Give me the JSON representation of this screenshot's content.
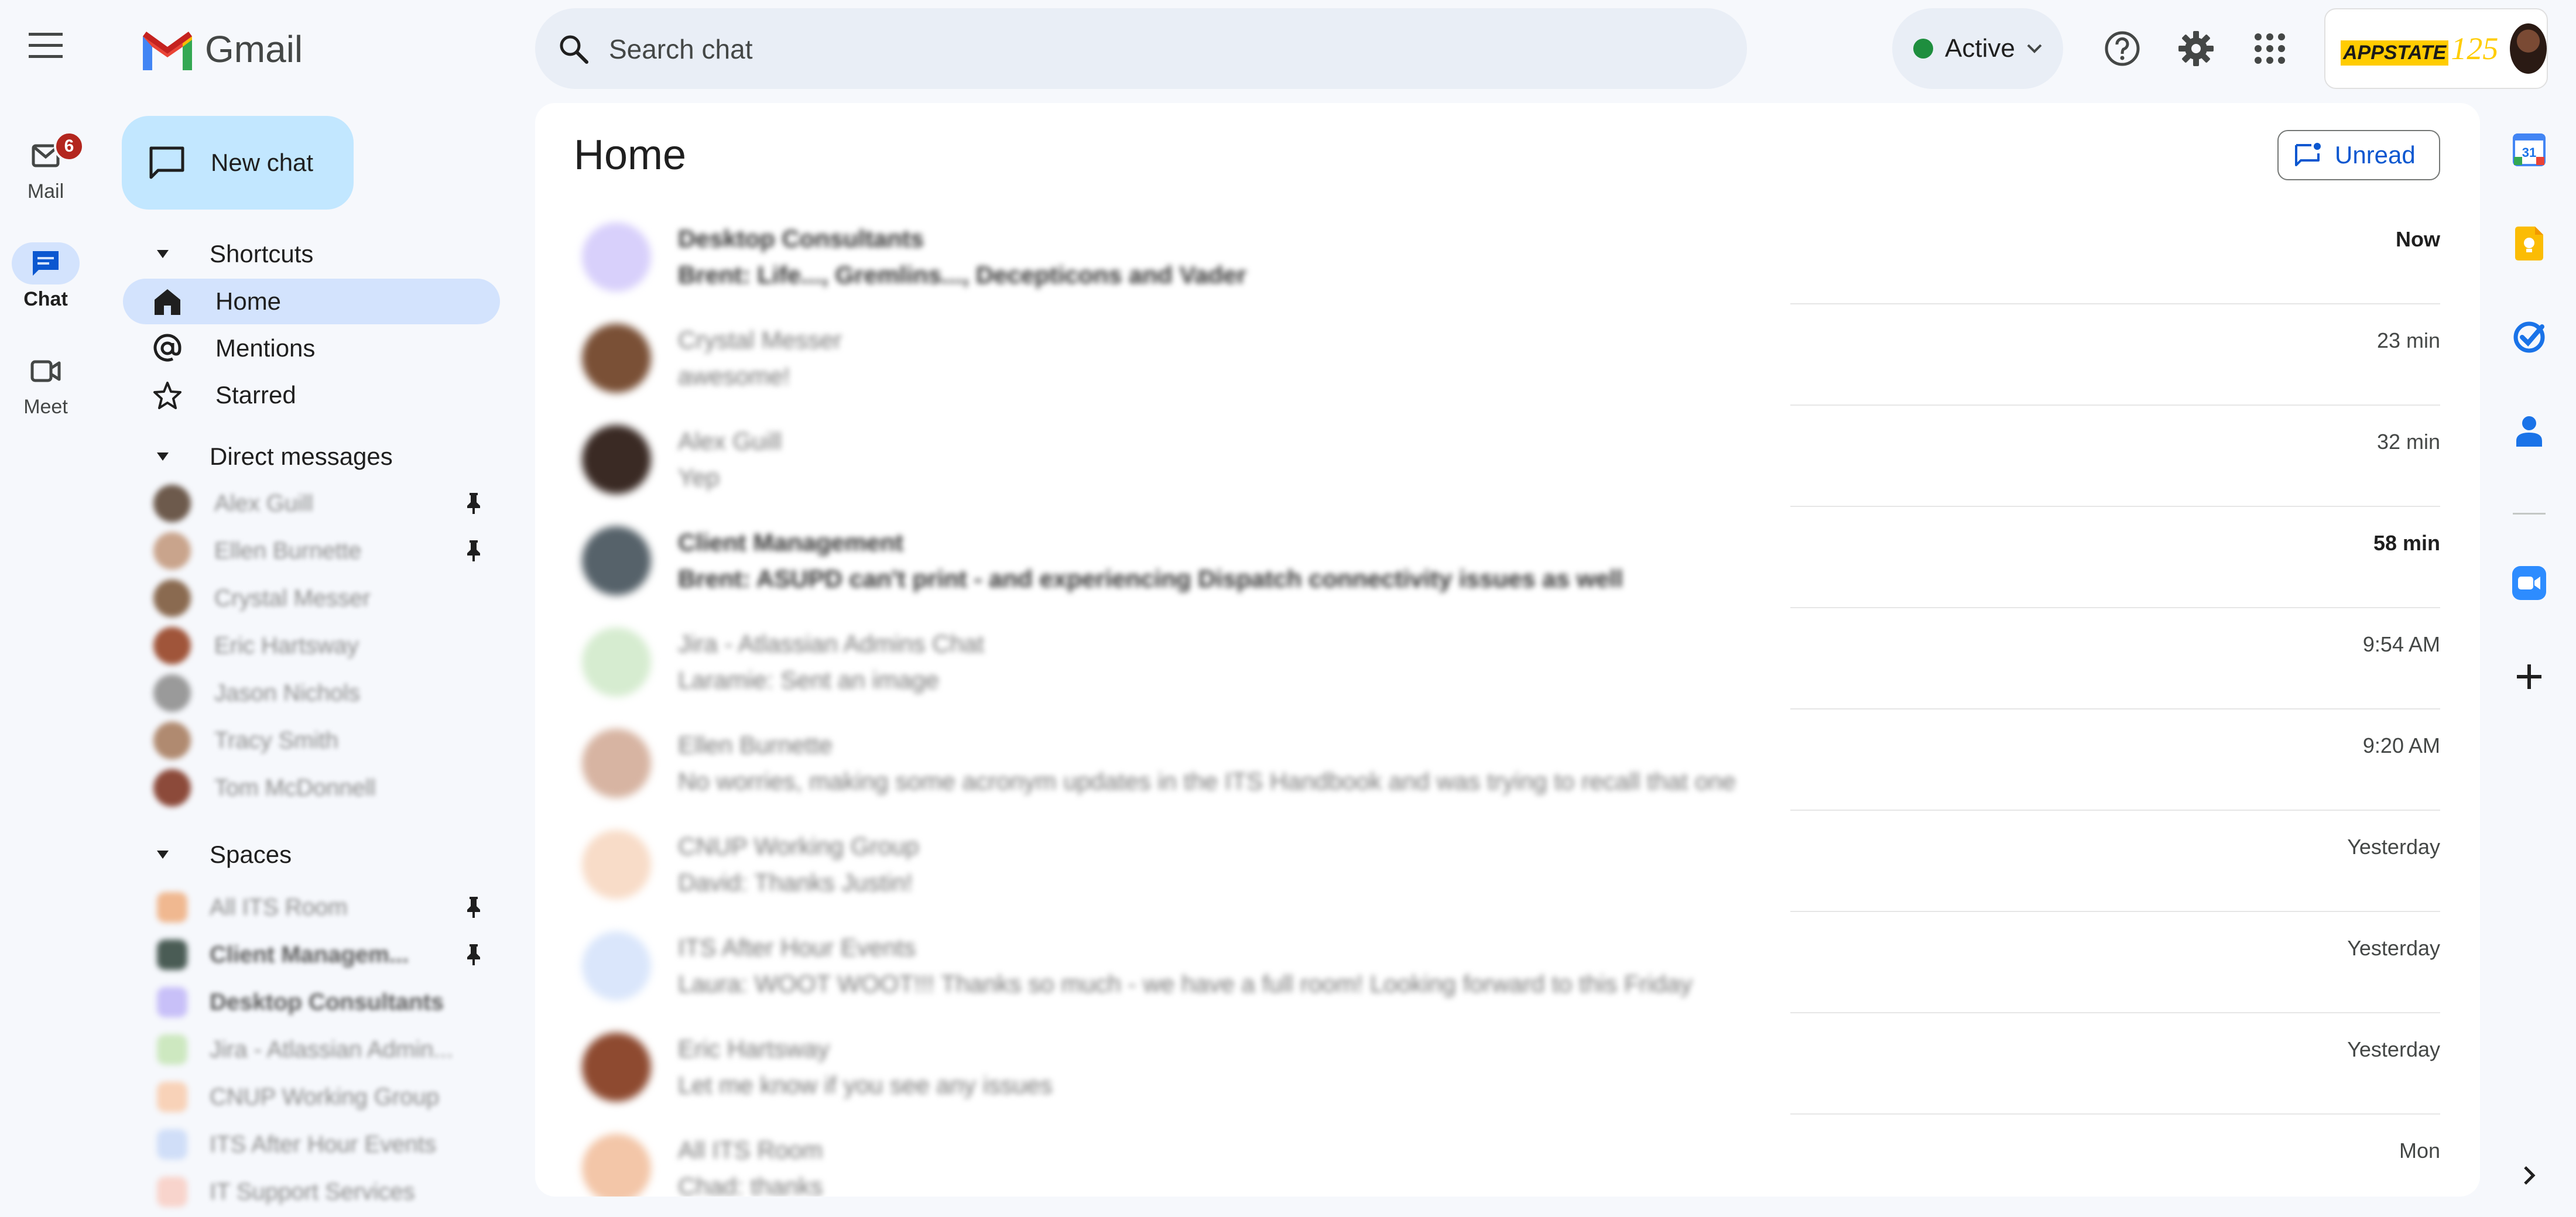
{
  "app": {
    "name": "Gmail",
    "logo_icon": "gmail-logo-icon"
  },
  "rail": [
    {
      "label": "Mail",
      "icon": "mail-icon",
      "badge": "6",
      "active": false
    },
    {
      "label": "Chat",
      "icon": "chat-icon",
      "active": true
    },
    {
      "label": "Meet",
      "icon": "meet-video-icon",
      "active": false
    }
  ],
  "header": {
    "search_placeholder": "Search chat",
    "status_label": "Active",
    "status_color": "#1e8e3e",
    "icons": [
      "help-icon",
      "settings-gear-icon",
      "apps-grid-icon"
    ],
    "org_logo_text": "APPSTATE",
    "org_logo_number": "125"
  },
  "sidebar": {
    "new_chat_label": "New chat",
    "shortcuts": {
      "heading": "Shortcuts",
      "items": [
        {
          "label": "Home",
          "icon": "home-icon",
          "active": true
        },
        {
          "label": "Mentions",
          "icon": "at-sign-icon",
          "active": false
        },
        {
          "label": "Starred",
          "icon": "star-icon",
          "active": false
        }
      ]
    },
    "direct_messages": {
      "heading": "Direct messages",
      "items": [
        {
          "name": "Alex Guill",
          "pinned": true,
          "avatar_color": "#6d5a4c"
        },
        {
          "name": "Ellen Burnette",
          "pinned": true,
          "avatar_color": "#c9a48c"
        },
        {
          "name": "Crystal Messer",
          "pinned": false,
          "avatar_color": "#8a6a50"
        },
        {
          "name": "Eric Hartsway",
          "pinned": false,
          "avatar_color": "#a0553a"
        },
        {
          "name": "Jason Nichols",
          "pinned": false,
          "avatar_color": "#9a9a9a"
        },
        {
          "name": "Tracy Smith",
          "pinned": false,
          "avatar_color": "#b08a70"
        },
        {
          "name": "Tom McDonnell",
          "pinned": false,
          "avatar_color": "#8c4a3a"
        }
      ]
    },
    "spaces": {
      "heading": "Spaces",
      "items": [
        {
          "name": "All ITS Room",
          "pinned": true,
          "bold": false,
          "avatar_color": "#f0b890"
        },
        {
          "name": "Client Managem...",
          "pinned": true,
          "bold": true,
          "avatar_color": "#4a5c55"
        },
        {
          "name": "Desktop Consultants",
          "pinned": false,
          "bold": true,
          "avatar_color": "#c8c0f8"
        },
        {
          "name": "Jira - Atlassian Admin...",
          "pinned": false,
          "bold": false,
          "avatar_color": "#cde8c0"
        },
        {
          "name": "CNUP Working Group",
          "pinned": false,
          "bold": false,
          "avatar_color": "#f8d2b8"
        },
        {
          "name": "ITS After Hour Events",
          "pinned": false,
          "bold": false,
          "avatar_color": "#d0def8"
        },
        {
          "name": "IT Support Services",
          "pinned": false,
          "bold": false,
          "avatar_color": "#f8d4cc"
        }
      ]
    }
  },
  "main": {
    "title": "Home",
    "unread_label": "Unread",
    "conversations": [
      {
        "name": "Desktop Consultants",
        "snippet": "Brent: Life..., Gremlins..., Decepticons and Vader",
        "time": "Now",
        "bold": true,
        "avatar_color": "#d8d0fb"
      },
      {
        "name": "Crystal Messer",
        "snippet": "awesome!",
        "time": "23 min",
        "bold": false,
        "avatar_color": "#7a5036"
      },
      {
        "name": "Alex Guill",
        "snippet": "Yep",
        "time": "32 min",
        "bold": false,
        "avatar_color": "#3a2a24"
      },
      {
        "name": "Client Management",
        "snippet": "Brent: ASUPD can't print - and experiencing Dispatch connectivity issues as well",
        "time": "58 min",
        "bold": true,
        "avatar_color": "#56626a"
      },
      {
        "name": "Jira - Atlassian Admins Chat",
        "snippet": "Laramie: Sent an image",
        "time": "9:54 AM",
        "bold": false,
        "avatar_color": "#d6ecd0"
      },
      {
        "name": "Ellen Burnette",
        "snippet": "No worries, making some acronym updates in the ITS Handbook and was trying to recall that one",
        "time": "9:20 AM",
        "bold": false,
        "avatar_color": "#d7b4a2"
      },
      {
        "name": "CNUP Working Group",
        "snippet": "David: Thanks Justin!",
        "time": "Yesterday",
        "bold": false,
        "avatar_color": "#f8dcc8"
      },
      {
        "name": "ITS After Hour Events",
        "snippet": "Laura: WOOT WOOT!!! Thanks so much - we have a full room! Looking forward to this Friday",
        "time": "Yesterday",
        "bold": false,
        "avatar_color": "#dae6fb"
      },
      {
        "name": "Eric Hartsway",
        "snippet": "Let me know if you see any issues",
        "time": "Yesterday",
        "bold": false,
        "avatar_color": "#8e4a30"
      },
      {
        "name": "All ITS Room",
        "snippet": "Chad: thanks",
        "time": "Mon",
        "bold": false,
        "avatar_color": "#f3c6a8"
      }
    ]
  },
  "side_panel": {
    "icons": [
      "calendar-icon",
      "keep-icon",
      "tasks-icon",
      "contacts-icon",
      "zoom-icon",
      "add-icon",
      "chevron-right-icon"
    ],
    "calendar_day": "31"
  }
}
